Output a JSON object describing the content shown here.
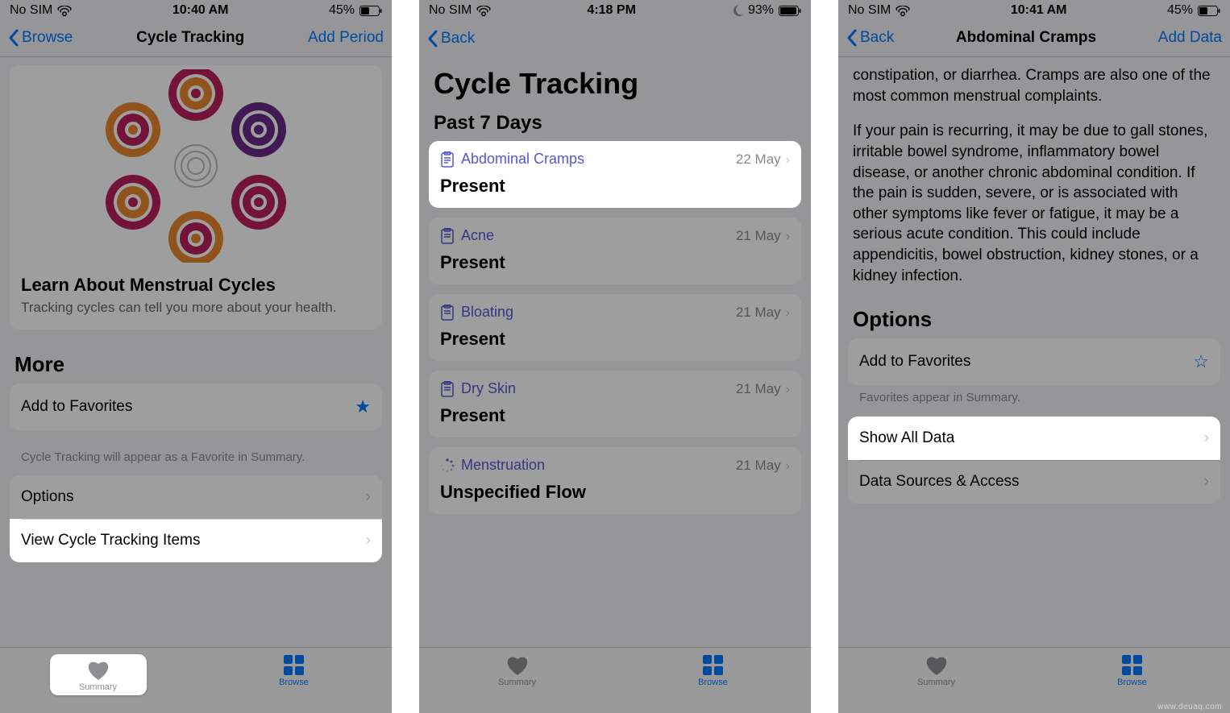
{
  "watermark": "www.deuaq.com",
  "screens": [
    {
      "status": {
        "carrier": "No SIM",
        "time": "10:40 AM",
        "battery_pct": "45%",
        "moon": false
      },
      "nav": {
        "back": "Browse",
        "title": "Cycle Tracking",
        "right": "Add Period"
      },
      "promo": {
        "title": "Learn About Menstrual Cycles",
        "subtitle": "Tracking cycles can tell you more about your health."
      },
      "more_header": "More",
      "favorites_row": "Add to Favorites",
      "favorites_caption": "Cycle Tracking will appear as a Favorite in Summary.",
      "options_row": "Options",
      "view_items_row": "View Cycle Tracking Items",
      "tabs": {
        "summary": "Summary",
        "browse": "Browse"
      }
    },
    {
      "status": {
        "carrier": "No SIM",
        "time": "4:18 PM",
        "battery_pct": "93%",
        "moon": true
      },
      "nav": {
        "back": "Back",
        "title": "",
        "right": ""
      },
      "large_title": "Cycle Tracking",
      "section": "Past 7 Days",
      "items": [
        {
          "name": "Abdominal Cramps",
          "date": "22 May",
          "value": "Present",
          "icon": "clipboard"
        },
        {
          "name": "Acne",
          "date": "21 May",
          "value": "Present",
          "icon": "clipboard"
        },
        {
          "name": "Bloating",
          "date": "21 May",
          "value": "Present",
          "icon": "clipboard"
        },
        {
          "name": "Dry Skin",
          "date": "21 May",
          "value": "Present",
          "icon": "clipboard"
        },
        {
          "name": "Menstruation",
          "date": "21 May",
          "value": "Unspecified Flow",
          "icon": "spinner"
        }
      ],
      "tabs": {
        "summary": "Summary",
        "browse": "Browse"
      }
    },
    {
      "status": {
        "carrier": "No SIM",
        "time": "10:41 AM",
        "battery_pct": "45%",
        "moon": false
      },
      "nav": {
        "back": "Back",
        "title": "Abdominal Cramps",
        "right": "Add Data"
      },
      "para1": "constipation, or diarrhea. Cramps are also one of the most common menstrual complaints.",
      "para2": "If your pain is recurring, it may be due to gall stones, irritable bowel syndrome, inflammatory bowel disease, or another chronic abdominal condition. If the pain is sudden, severe, or is associated with other symptoms like fever or fatigue, it may be a serious acute condition. This could include appendicitis, bowel obstruction, kidney stones, or a kidney infection.",
      "options_header": "Options",
      "favorites_row": "Add to Favorites",
      "favorites_caption": "Favorites appear in Summary.",
      "show_all_row": "Show All Data",
      "sources_row": "Data Sources & Access",
      "tabs": {
        "summary": "Summary",
        "browse": "Browse"
      }
    }
  ]
}
